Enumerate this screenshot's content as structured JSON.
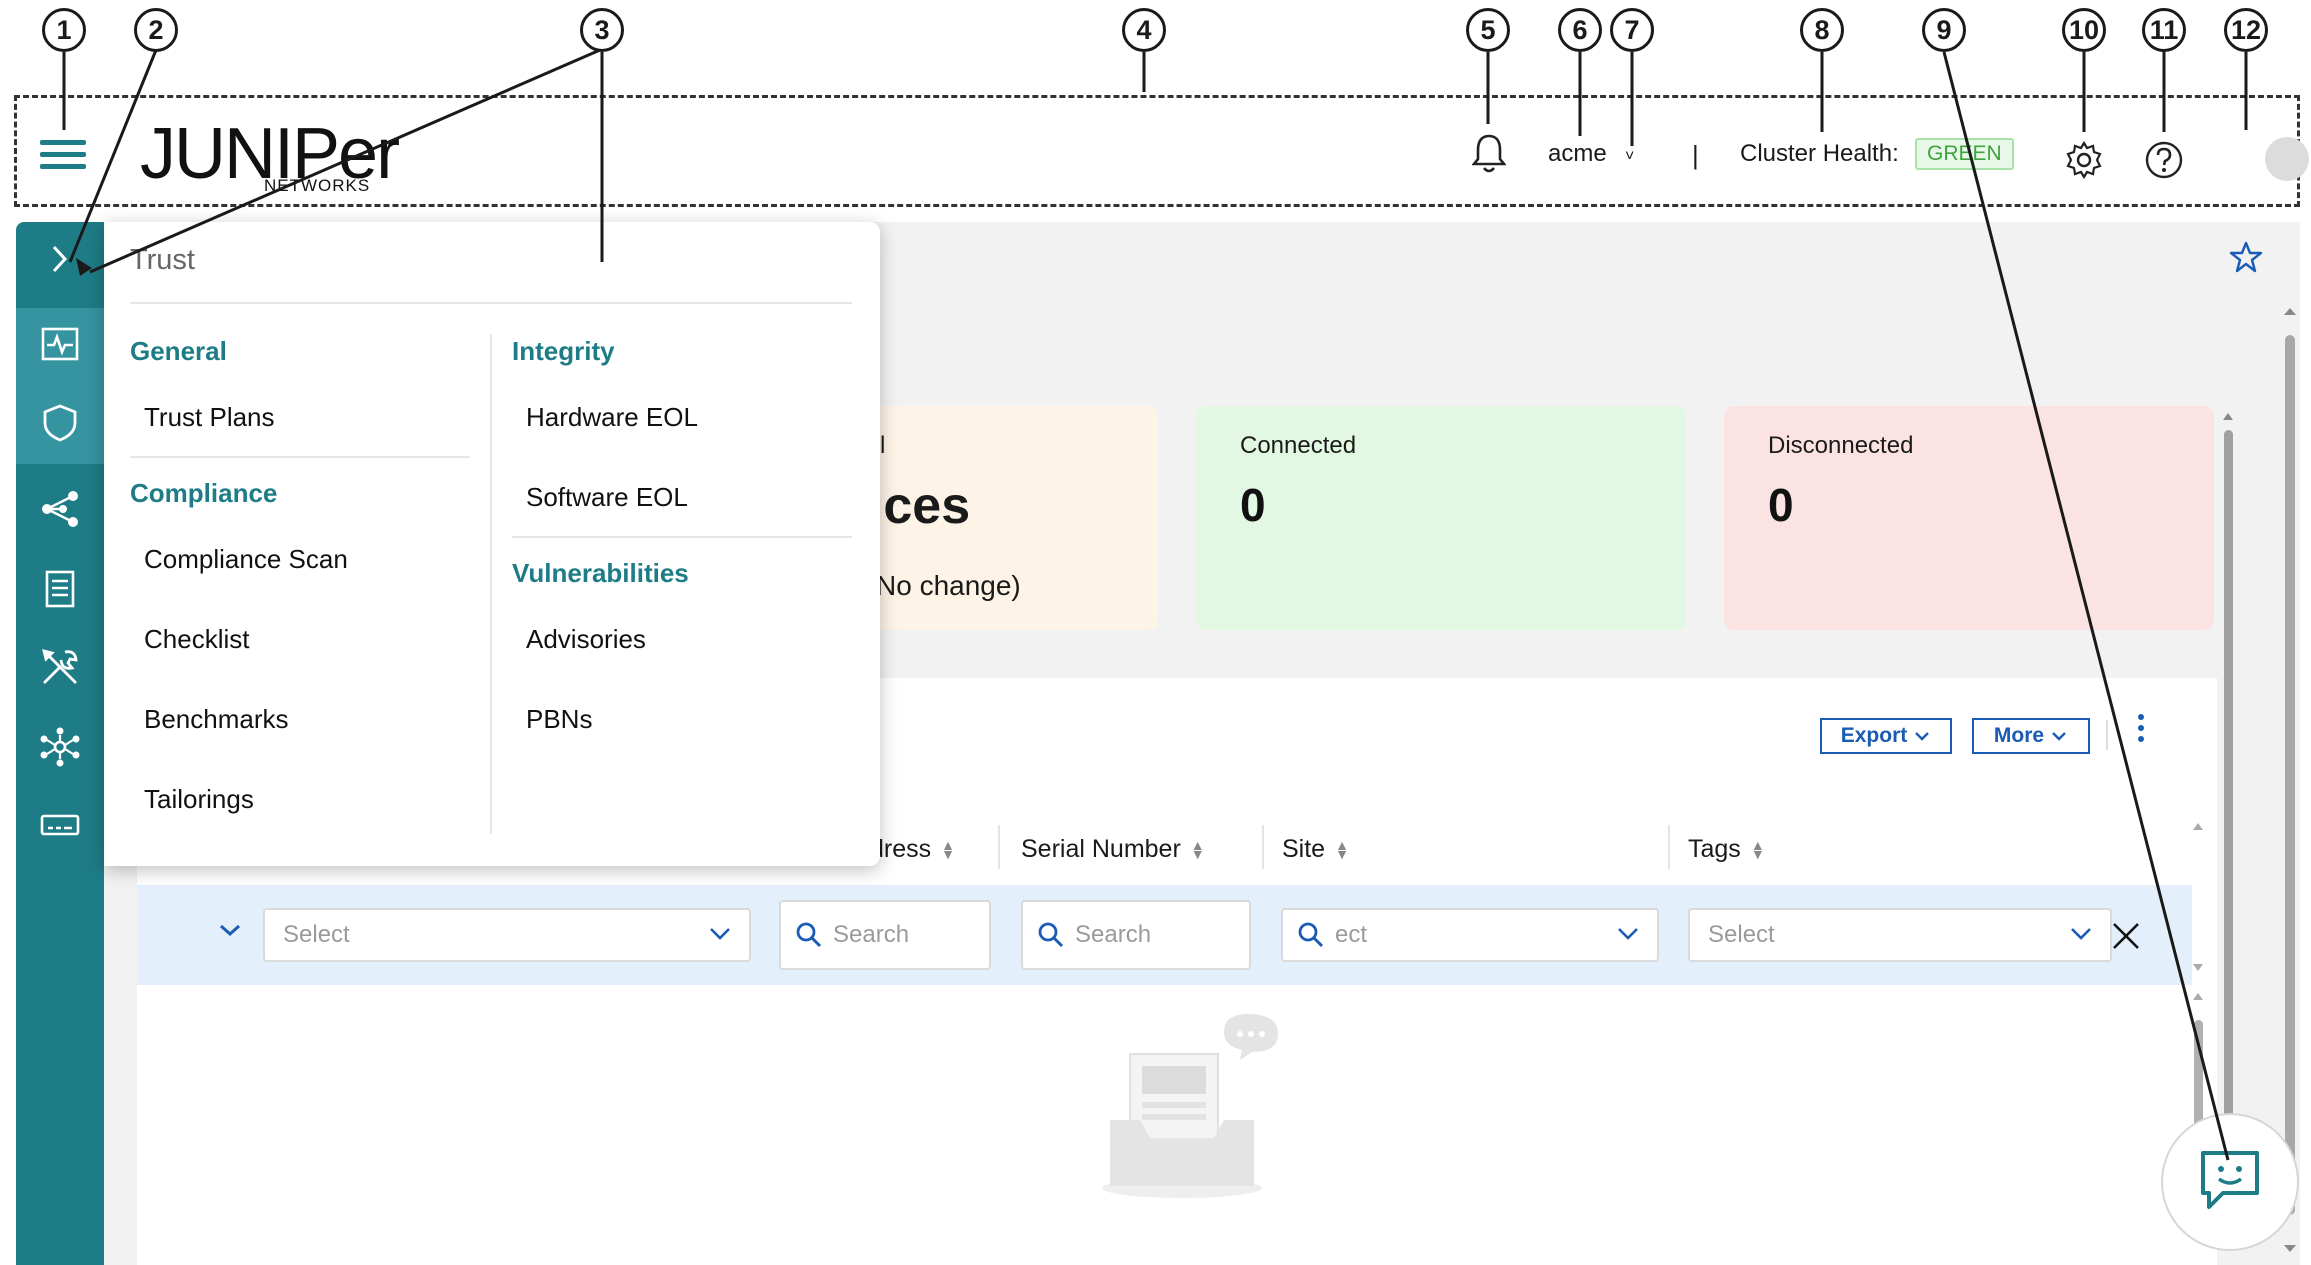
{
  "callouts": [
    "1",
    "2",
    "3",
    "4",
    "5",
    "6",
    "7",
    "8",
    "9",
    "10",
    "11",
    "12"
  ],
  "header": {
    "logo_text": "JUNIPer",
    "logo_sub": "NETWORKS",
    "tenant": "acme",
    "tenant_chevron": "˅",
    "separator": "|",
    "cluster_health_label": "Cluster Health:",
    "cluster_health_status": "GREEN",
    "icons": [
      "hamburger-menu-icon",
      "bell-icon",
      "gear-icon",
      "help-icon",
      "user-avatar"
    ]
  },
  "sidebar": {
    "items": [
      {
        "icon": "expand-chevron-icon"
      },
      {
        "icon": "activity-monitor-icon"
      },
      {
        "icon": "shield-icon"
      },
      {
        "icon": "share-nodes-icon"
      },
      {
        "icon": "document-icon"
      },
      {
        "icon": "tools-icon"
      },
      {
        "icon": "network-topology-icon"
      },
      {
        "icon": "device-icon"
      }
    ]
  },
  "flyout": {
    "title": "Trust",
    "left": {
      "general_heading": "General",
      "trust_plans": "Trust Plans",
      "compliance_heading": "Compliance",
      "compliance_scan": "Compliance Scan",
      "checklist": "Checklist",
      "benchmarks": "Benchmarks",
      "tailorings": "Tailorings"
    },
    "right": {
      "integrity_heading": "Integrity",
      "hardware_eol": "Hardware EOL",
      "software_eol": "Software EOL",
      "vulnerabilities_heading": "Vulnerabilities",
      "advisories": "Advisories",
      "pbns": "PBNs"
    }
  },
  "cards": {
    "first": {
      "partial_label": "l",
      "partial_value": "vices",
      "partial_change": "No change)",
      "color": "#fdf3e6"
    },
    "connected": {
      "label": "Connected",
      "value": "0",
      "color": "#e3f8e3"
    },
    "disconnected": {
      "label": "Disconnected",
      "value": "0",
      "color": "#fbe3e3"
    }
  },
  "toolbar": {
    "export_label": "Export",
    "more_label": "More"
  },
  "table": {
    "columns": [
      "dress",
      "Serial Number",
      "Site",
      "Tags"
    ],
    "filters": {
      "select1": "Select",
      "search1": "Search",
      "search2": "Search",
      "site_select": "ect",
      "tags_select": "Select"
    }
  },
  "colors": {
    "brand_teal": "#1e7c87",
    "link_blue": "#1a5bb3",
    "health_green": "#3fa43f"
  }
}
